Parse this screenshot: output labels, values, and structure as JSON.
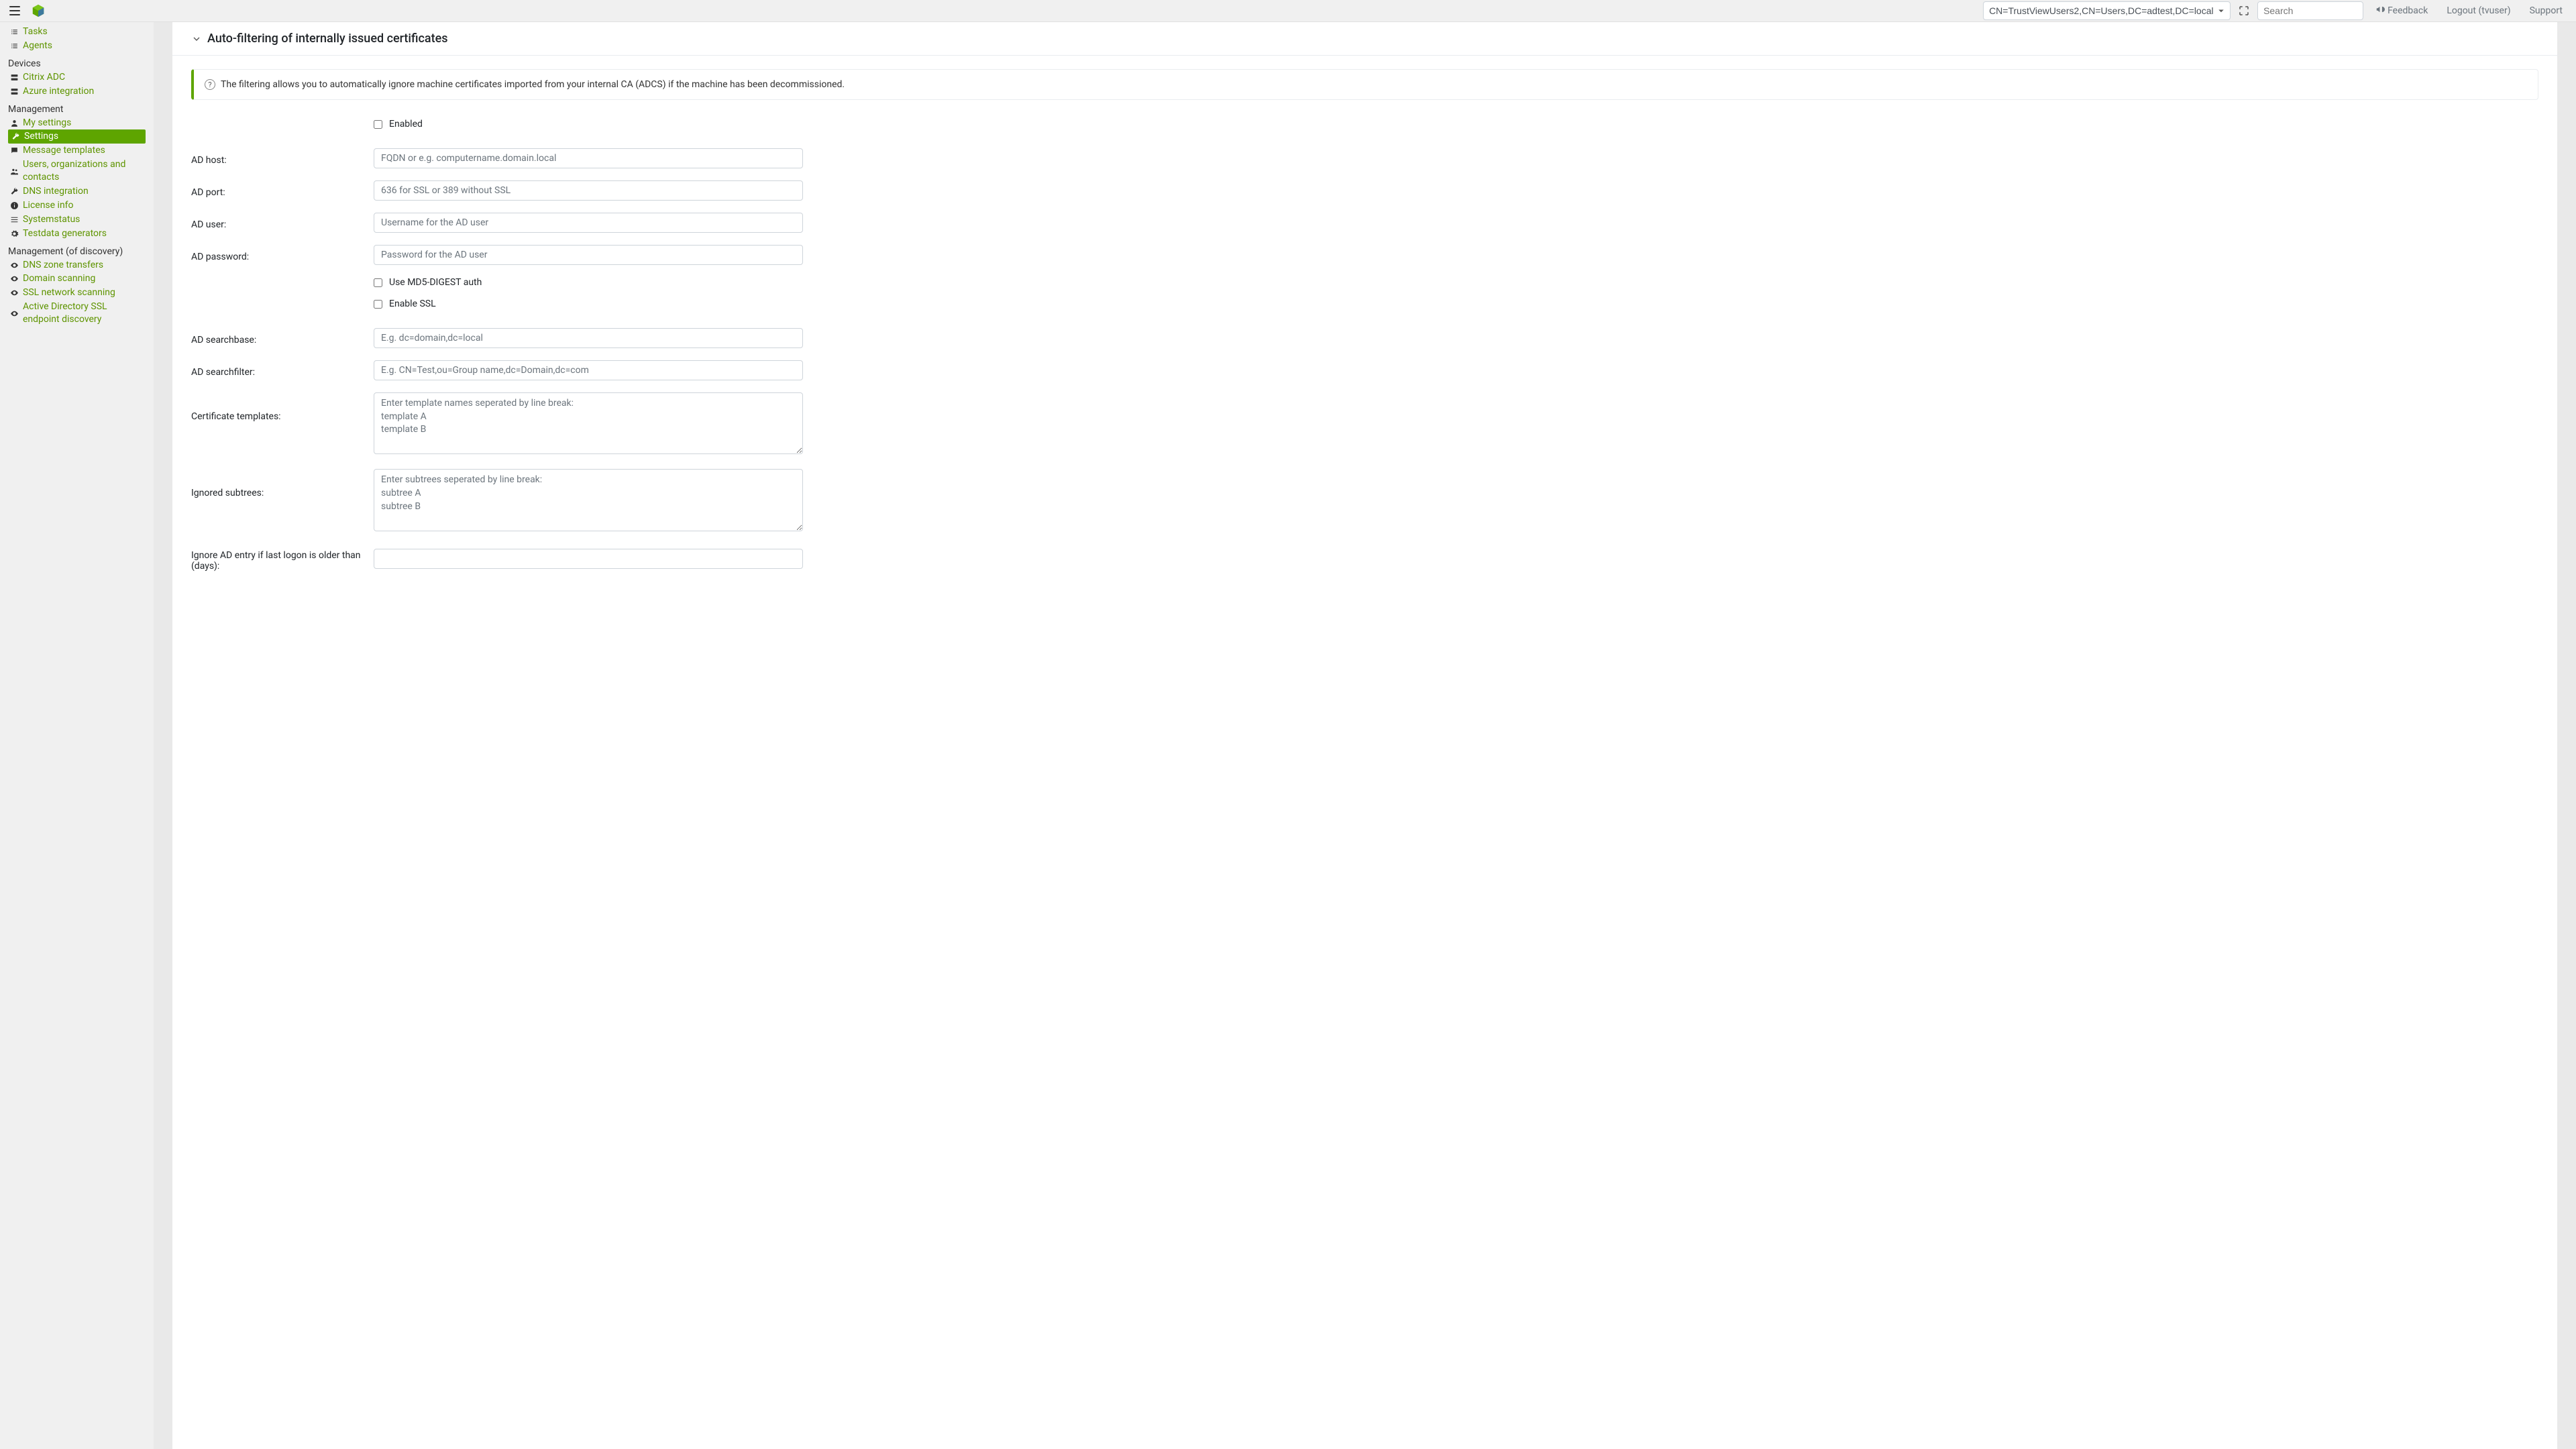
{
  "navbar": {
    "select_value": "CN=TrustViewUsers2,CN=Users,DC=adtest,DC=local",
    "search_placeholder": "Search",
    "feedback": "Feedback",
    "logout": "Logout (tvuser)",
    "support": "Support"
  },
  "sidebar": {
    "top": [
      {
        "icon": "list",
        "label": "Tasks"
      },
      {
        "icon": "list",
        "label": "Agents"
      }
    ],
    "devices_header": "Devices",
    "devices": [
      {
        "icon": "server",
        "label": "Citrix ADC"
      },
      {
        "icon": "server",
        "label": "Azure integration"
      }
    ],
    "management_header": "Management",
    "management": [
      {
        "icon": "user",
        "label": "My settings"
      },
      {
        "icon": "wrench",
        "label": "Settings",
        "active": true
      },
      {
        "icon": "chat",
        "label": "Message templates"
      },
      {
        "icon": "users",
        "label": "Users, organizations and contacts"
      },
      {
        "icon": "wrench",
        "label": "DNS integration"
      },
      {
        "icon": "info",
        "label": "License info"
      },
      {
        "icon": "bars",
        "label": "Systemstatus"
      },
      {
        "icon": "gear",
        "label": "Testdata generators"
      }
    ],
    "discovery_header": "Management (of discovery)",
    "discovery": [
      {
        "icon": "eye",
        "label": "DNS zone transfers"
      },
      {
        "icon": "eye",
        "label": "Domain scanning"
      },
      {
        "icon": "eye",
        "label": "SSL network scanning"
      },
      {
        "icon": "eye",
        "label": "Active Directory SSL endpoint discovery"
      }
    ]
  },
  "section": {
    "title": "Auto-filtering of internally issued certificates",
    "info": "The filtering allows you to automatically ignore machine certificates imported from your internal CA (ADCS) if the machine has been decommissioned."
  },
  "form": {
    "enabled_label": "Enabled",
    "ad_host_label": "AD host:",
    "ad_host_placeholder": "FQDN or e.g. computername.domain.local",
    "ad_port_label": "AD port:",
    "ad_port_placeholder": "636 for SSL or 389 without SSL",
    "ad_user_label": "AD user:",
    "ad_user_placeholder": "Username for the AD user",
    "ad_password_label": "AD password:",
    "ad_password_placeholder": "Password for the AD user",
    "md5_label": "Use MD5-DIGEST auth",
    "ssl_label": "Enable SSL",
    "ad_searchbase_label": "AD searchbase:",
    "ad_searchbase_placeholder": "E.g. dc=domain,dc=local",
    "ad_searchfilter_label": "AD searchfilter:",
    "ad_searchfilter_placeholder": "E.g. CN=Test,ou=Group name,dc=Domain,dc=com",
    "cert_templates_label": "Certificate templates:",
    "cert_templates_placeholder": "Enter template names seperated by line break:\ntemplate A\ntemplate B",
    "ignored_subtrees_label": "Ignored subtrees:",
    "ignored_subtrees_placeholder": "Enter subtrees seperated by line break:\nsubtree A\nsubtree B",
    "ignore_last_logon_label": "Ignore AD entry if last logon is older than (days):"
  }
}
